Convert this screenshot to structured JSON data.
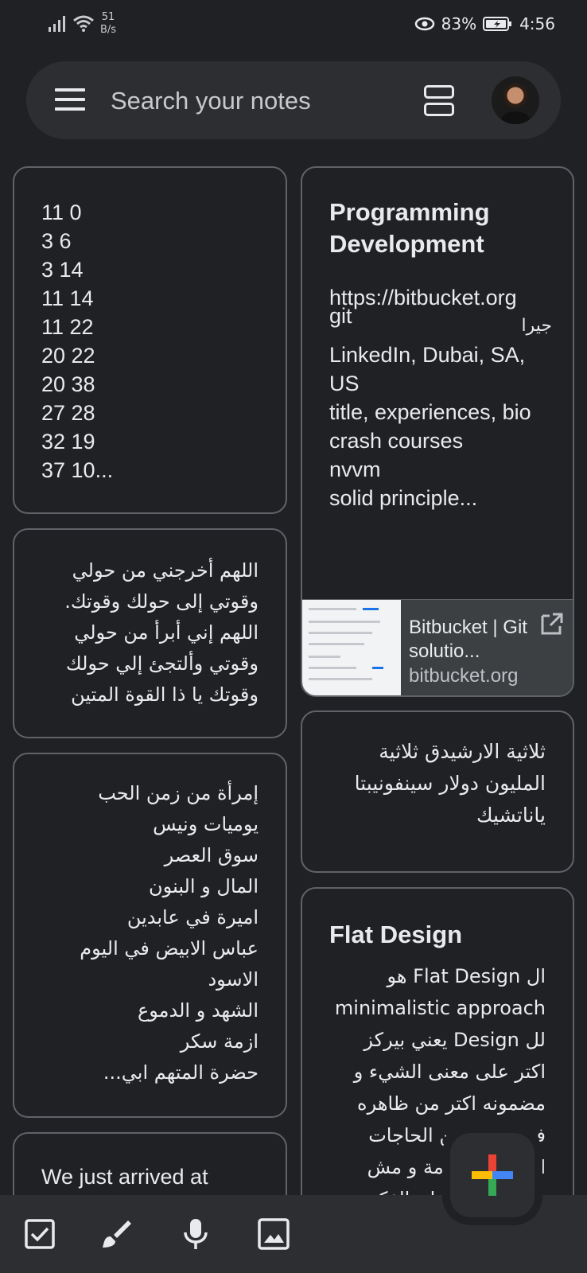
{
  "status": {
    "net_speed_value": "51",
    "net_speed_unit": "B/s",
    "battery": "83%",
    "time": "4:56"
  },
  "search": {
    "placeholder": "Search your notes"
  },
  "notes": {
    "n1": {
      "body": "11 0\n3 6\n3 14\n11 14\n11 22\n20 22\n20 38\n27 28\n32 19\n37 10..."
    },
    "n2": {
      "title": "Programming Development",
      "body": "git\nhttps://bitbucket.org\nجيرا\nLinkedIn, Dubai, SA, US\ntitle, experiences, bio\ncrash courses\nnvvm\nsolid principle...",
      "link_title": "Bitbucket | Git solutio...",
      "link_domain": "bitbucket.org"
    },
    "n3": {
      "body": "اللهم أخرجني من حولي وقوتي إلى حولك وقوتك. اللهم إني أبرأ من حولي وقوتي وألتجئ إلي حولك وقوتك يا ذا القوة المتين"
    },
    "n4": {
      "body": "ثلاثية الارشيدق ثلاثية المليون دولار سينفونيبتا ياناتشيك"
    },
    "n5": {
      "body": "إمرأة من زمن الحب\nيوميات ونيس\nسوق العصر\nالمال و البنون\nاميرة في عابدين\nعباس الابيض في اليوم الاسود\nالشهد و الدموع\nازمة سكر\nحضرة المتهم ابي..."
    },
    "n6": {
      "title": "Flat Design",
      "body": "ال Flat Design هو minimalistic approach لل Design يعني بيركز اكتر على معنى الشيء و مضمونه اكتر من ظاهره فبيستغني عن الحاجات اللي مالها لازمة و مش محتاج فيها الا ان الفكرة يتتتطلب..."
    },
    "n7": {
      "body": "We just arrived at"
    }
  },
  "icons": {
    "menu": "hamburger-menu-icon",
    "layout": "list-view-icon",
    "checkbox": "checkbox-icon",
    "brush": "brush-icon",
    "mic": "microphone-icon",
    "image": "image-icon",
    "fab": "plus-icon",
    "open": "open-in-new-icon"
  },
  "colors": {
    "background": "#202124",
    "surface": "#2d2e31",
    "border": "#5f6368",
    "fab_blue": "#4285f4",
    "fab_red": "#ea4335",
    "fab_yellow": "#fbbc04",
    "fab_green": "#34a853"
  }
}
